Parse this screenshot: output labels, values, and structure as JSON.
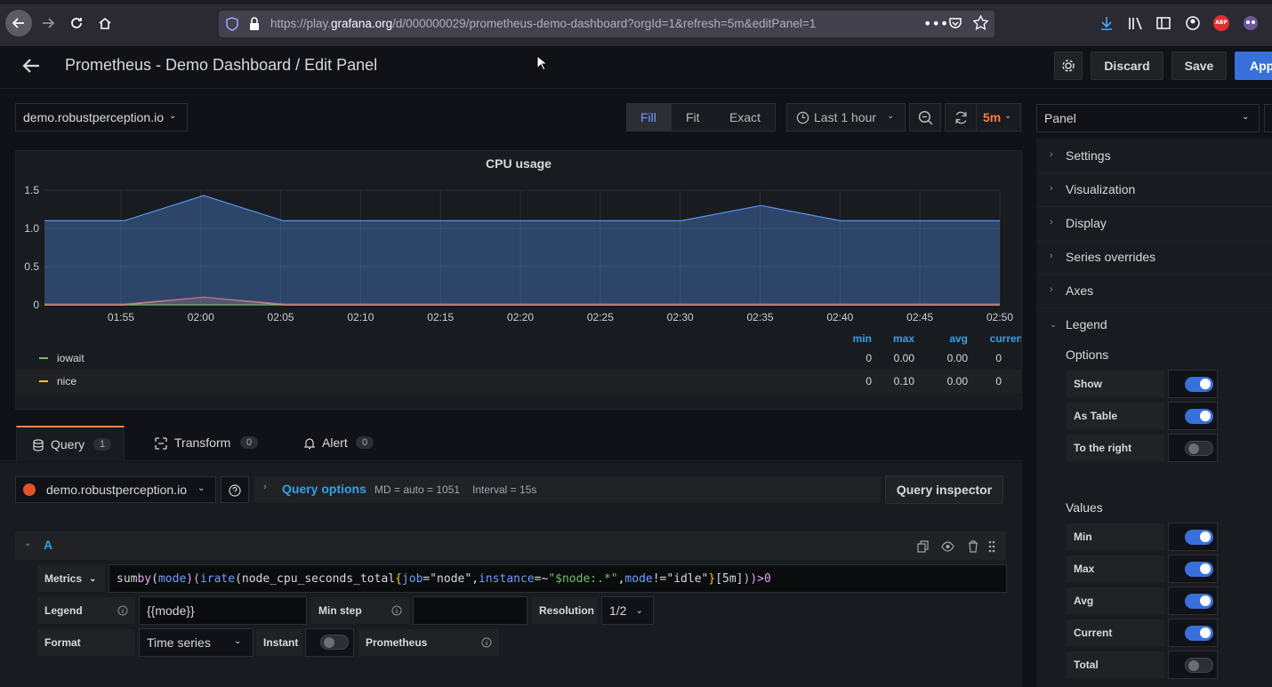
{
  "browser": {
    "url_prefix": "https://play.",
    "url_host": "grafana.org",
    "url_path": "/d/000000029/prometheus-demo-dashboard?orgId=1&refresh=5m&editPanel=1"
  },
  "header": {
    "title": "Prometheus - Demo Dashboard / Edit Panel",
    "discard_label": "Discard",
    "save_label": "Save",
    "apply_label": "Apply"
  },
  "toolbar": {
    "datasource_select": "demo.robustperception.io",
    "fill_label": "Fill",
    "fit_label": "Fit",
    "exact_label": "Exact",
    "time_range": "Last 1 hour",
    "refresh_interval": "5m"
  },
  "panel": {
    "title": "CPU usage"
  },
  "chart_data": {
    "type": "area",
    "title": "CPU usage",
    "ylim": [
      0,
      1.5
    ],
    "yticks": [
      "1.5",
      "1.0",
      "0.5",
      "0"
    ],
    "xticks": [
      "01:55",
      "02:00",
      "02:05",
      "02:10",
      "02:15",
      "02:20",
      "02:25",
      "02:30",
      "02:35",
      "02:40",
      "02:45",
      "02:50"
    ],
    "grid": true,
    "series": [
      {
        "name": "iowait",
        "color": "#73bf69",
        "values": [
          0,
          0,
          0,
          0,
          0,
          0,
          0,
          0,
          0,
          0,
          0,
          0,
          0
        ]
      },
      {
        "name": "nice",
        "color": "#f2cc0c",
        "values": [
          0,
          0,
          0.1,
          0,
          0,
          0,
          0,
          0,
          0,
          0,
          0,
          0,
          0
        ]
      },
      {
        "color": "#f2495c",
        "values": [
          0.01,
          0.01,
          0.1,
          0.01,
          0.01,
          0.01,
          0.01,
          0.01,
          0.01,
          0.01,
          0.01,
          0.01,
          0.01
        ]
      },
      {
        "color": "#5794f2",
        "values": [
          1.1,
          1.1,
          1.43,
          1.1,
          1.1,
          1.1,
          1.1,
          1.1,
          1.1,
          1.3,
          1.1,
          1.1,
          1.1
        ]
      }
    ]
  },
  "legend": {
    "headers": [
      "min",
      "max",
      "avg",
      "current"
    ],
    "rows": [
      {
        "name": "iowait",
        "color": "#73bf69",
        "min": "0",
        "max": "0.00",
        "avg": "0.00",
        "current": "0"
      },
      {
        "name": "nice",
        "color": "#f2cc0c",
        "min": "0",
        "max": "0.10",
        "avg": "0.00",
        "current": "0"
      }
    ]
  },
  "tabs": [
    {
      "label": "Query",
      "count": "1"
    },
    {
      "label": "Transform",
      "count": "0"
    },
    {
      "label": "Alert",
      "count": "0"
    }
  ],
  "query": {
    "datasource": "demo.robustperception.io",
    "options_label": "Query options",
    "md_info": "MD = auto = 1051",
    "interval_info": "Interval = 15s",
    "inspector_label": "Query inspector",
    "ref_id": "A",
    "metrics_label": "Metrics",
    "expr": {
      "p1": "sum ",
      "p2": "by",
      "p3": "(",
      "p4": "mode",
      "p5": ")(",
      "p6": "irate",
      "p7": "(node_cpu_seconds_total",
      "p8": "{",
      "p9": "job",
      "p10": "=",
      "p11": "\"node\"",
      "p12": ", ",
      "p13": "instance",
      "p14": "=~",
      "p15": "\"$node:.*\"",
      "p16": ", ",
      "p17": "mode",
      "p18": "!=",
      "p19": "\"idle\"",
      "p20": "}",
      "p21": "[5m]",
      "p22": ")) ",
      "p23": ">",
      "p24": " 0"
    },
    "legend_label": "Legend",
    "legend_value": "{{mode}}",
    "min_step_label": "Min step",
    "resolution_label": "Resolution",
    "resolution_value": "1/2",
    "format_label": "Format",
    "format_value": "Time series",
    "instant_label": "Instant",
    "prometheus_label": "Prometheus"
  },
  "options_pane": {
    "select_value": "Panel",
    "sections": [
      "Settings",
      "Visualization",
      "Display",
      "Series overrides",
      "Axes",
      "Legend"
    ],
    "options_heading": "Options",
    "options": [
      {
        "label": "Show",
        "on": true
      },
      {
        "label": "As Table",
        "on": true
      },
      {
        "label": "To the right",
        "on": false
      }
    ],
    "values_heading": "Values",
    "values": [
      {
        "label": "Min",
        "on": true
      },
      {
        "label": "Max",
        "on": true
      },
      {
        "label": "Avg",
        "on": true
      },
      {
        "label": "Current",
        "on": true
      },
      {
        "label": "Total",
        "on": false
      }
    ]
  }
}
